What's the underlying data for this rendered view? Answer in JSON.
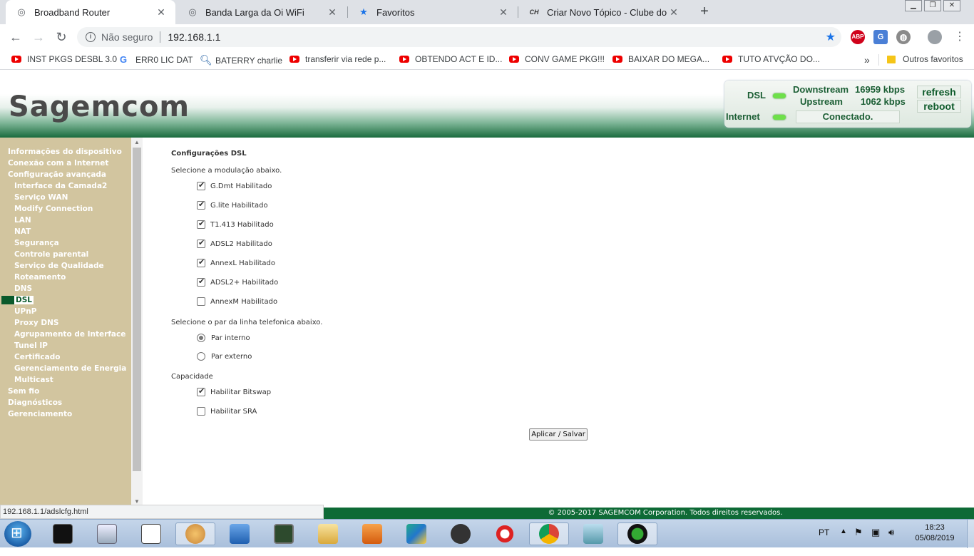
{
  "browser": {
    "tabs": [
      {
        "title": "Broadband Router",
        "active": true
      },
      {
        "title": "Banda Larga da Oi WiFi",
        "active": false
      },
      {
        "title": "Favoritos",
        "active": false
      },
      {
        "title": "Criar Novo Tópico - Clube do Ha",
        "active": false
      }
    ],
    "address": {
      "security": "Não seguro",
      "url": "192.168.1.1"
    },
    "status_url": "192.168.1.1/adslcfg.html"
  },
  "bookmarks": [
    {
      "label": "INST PKGS DESBL 3.0",
      "icon": "youtube-icon"
    },
    {
      "label": "ERR0 LIC DAT",
      "icon": "google-icon"
    },
    {
      "label": "BATERRY charlie",
      "icon": "search-icon"
    },
    {
      "label": "transferir via rede p...",
      "icon": "youtube-icon"
    },
    {
      "label": "OBTENDO ACT E ID...",
      "icon": "youtube-icon"
    },
    {
      "label": "CONV GAME PKG!!!",
      "icon": "youtube-icon"
    },
    {
      "label": "BAIXAR DO MEGA...",
      "icon": "youtube-icon"
    },
    {
      "label": "TUTO ATVÇÃO DO...",
      "icon": "youtube-icon"
    }
  ],
  "bookmarks_more": "»",
  "other_bookmarks": "Outros favoritos",
  "router": {
    "logo": "Sagemcom",
    "status": {
      "dsl_label": "DSL",
      "internet_label": "Internet",
      "downstream_label": "Downstream",
      "downstream_value": "16959 kbps",
      "upstream_label": "Upstream",
      "upstream_value": "1062 kbps",
      "connection": "Conectado.",
      "refresh": "refresh",
      "reboot": "reboot"
    }
  },
  "menu": [
    {
      "label": "Informações do dispositivo",
      "level": 0
    },
    {
      "label": "Conexão com a Internet",
      "level": 0
    },
    {
      "label": "Configuração avançada",
      "level": 0
    },
    {
      "label": "Interface da Camada2",
      "level": 1
    },
    {
      "label": "Serviço WAN",
      "level": 1
    },
    {
      "label": "Modify Connection",
      "level": 1
    },
    {
      "label": "LAN",
      "level": 1
    },
    {
      "label": "NAT",
      "level": 1
    },
    {
      "label": "Segurança",
      "level": 1
    },
    {
      "label": "Controle parental",
      "level": 1
    },
    {
      "label": "Serviço de Qualidade",
      "level": 1
    },
    {
      "label": "Roteamento",
      "level": 1
    },
    {
      "label": "DNS",
      "level": 1
    },
    {
      "label": "DSL",
      "level": 1,
      "selected": true
    },
    {
      "label": "UPnP",
      "level": 1
    },
    {
      "label": "Proxy DNS",
      "level": 1
    },
    {
      "label": "Agrupamento de Interface",
      "level": 1
    },
    {
      "label": "Tunel IP",
      "level": 1
    },
    {
      "label": "Certificado",
      "level": 1
    },
    {
      "label": "Gerenciamento de Energia",
      "level": 1
    },
    {
      "label": "Multicast",
      "level": 1
    },
    {
      "label": "Sem fio",
      "level": 0
    },
    {
      "label": "Diagnósticos",
      "level": 0
    },
    {
      "label": "Gerenciamento",
      "level": 0
    }
  ],
  "dsl": {
    "title": "Configurações DSL",
    "modulation_prompt": "Selecione a modulação abaixo.",
    "modulations": [
      {
        "label": "G.Dmt Habilitado",
        "checked": true
      },
      {
        "label": "G.lite Habilitado",
        "checked": true
      },
      {
        "label": "T1.413 Habilitado",
        "checked": true
      },
      {
        "label": "ADSL2 Habilitado",
        "checked": true
      },
      {
        "label": "AnnexL Habilitado",
        "checked": true
      },
      {
        "label": "ADSL2+ Habilitado",
        "checked": true
      },
      {
        "label": "AnnexM Habilitado",
        "checked": false
      }
    ],
    "pair_prompt": "Selecione o par da linha telefonica abaixo.",
    "pairs": [
      {
        "label": "Par interno",
        "selected": true
      },
      {
        "label": "Par externo",
        "selected": false
      }
    ],
    "capability_label": "Capacidade",
    "capabilities": [
      {
        "label": "Habilitar Bitswap",
        "checked": true
      },
      {
        "label": "Habilitar SRA",
        "checked": false
      }
    ],
    "apply_button": "Aplicar / Salvar"
  },
  "footer": "© 2005-2017 SAGEMCOM Corporation. Todos direitos reservados.",
  "taskbar": {
    "language": "PT",
    "time": "18:23",
    "date": "05/08/2019"
  }
}
